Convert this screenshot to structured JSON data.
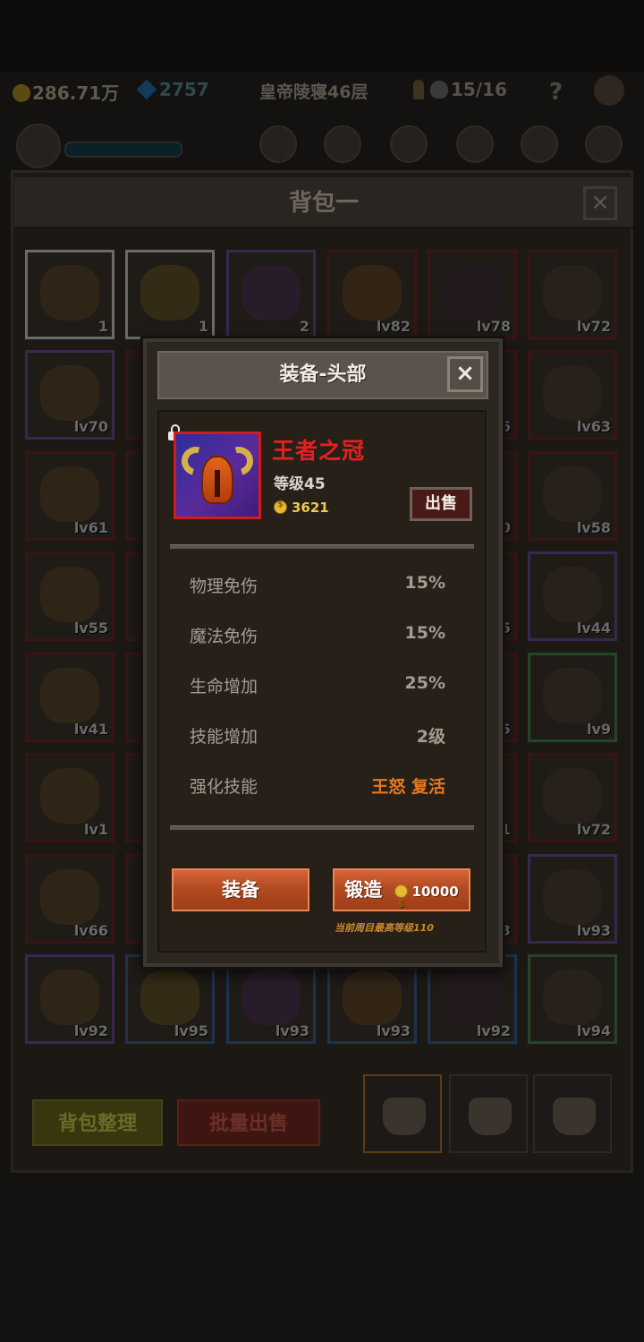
{
  "topbar": {
    "gold": "286.71万",
    "gems": "2757",
    "floor": "皇帝陵寝46层",
    "keys": "15/16",
    "help": "?"
  },
  "bag": {
    "title": "背包一",
    "close": "×",
    "tidy_label": "背包整理",
    "batch_sell_label": "批量出售",
    "slots": [
      {
        "label": "1"
      },
      {
        "label": "1"
      },
      {
        "label": "2"
      },
      {
        "label": "lv82"
      },
      {
        "label": "lv78"
      },
      {
        "label": "lv72"
      },
      {
        "label": "lv70"
      },
      {
        "label": ""
      },
      {
        "label": ""
      },
      {
        "label": ""
      },
      {
        "label": "6"
      },
      {
        "label": "lv63"
      },
      {
        "label": "lv61"
      },
      {
        "label": ""
      },
      {
        "label": ""
      },
      {
        "label": ""
      },
      {
        "label": "0"
      },
      {
        "label": "lv58"
      },
      {
        "label": "lv55"
      },
      {
        "label": ""
      },
      {
        "label": ""
      },
      {
        "label": ""
      },
      {
        "label": "5"
      },
      {
        "label": "lv44"
      },
      {
        "label": "lv41"
      },
      {
        "label": ""
      },
      {
        "label": ""
      },
      {
        "label": ""
      },
      {
        "label": "5"
      },
      {
        "label": "lv9"
      },
      {
        "label": "lv1"
      },
      {
        "label": ""
      },
      {
        "label": ""
      },
      {
        "label": ""
      },
      {
        "label": "1"
      },
      {
        "label": "lv72"
      },
      {
        "label": "lv66"
      },
      {
        "label": ""
      },
      {
        "label": ""
      },
      {
        "label": ""
      },
      {
        "label": "3"
      },
      {
        "label": "lv93"
      },
      {
        "label": "lv92"
      },
      {
        "label": "lv95"
      },
      {
        "label": "lv93"
      },
      {
        "label": "lv93"
      },
      {
        "label": "lv92"
      },
      {
        "label": "lv94"
      }
    ]
  },
  "modal": {
    "title": "装备-头部",
    "close": "×",
    "item": {
      "name": "王者之冠",
      "level": "等级45",
      "price": "3621",
      "sell_label": "出售"
    },
    "stats": [
      {
        "label": "物理免伤",
        "value": "15%"
      },
      {
        "label": "魔法免伤",
        "value": "15%"
      },
      {
        "label": "生命增加",
        "value": "25%"
      },
      {
        "label": "技能增加",
        "value": "2级"
      },
      {
        "label": "强化技能",
        "value": "王怒 复活"
      }
    ],
    "equip_label": "装备",
    "forge_label": "锻造",
    "forge_cost": "10000",
    "hint": "当前周目最高等级110"
  },
  "colors": {
    "item_name": "#e42121",
    "orange_stat": "#e4791e",
    "button": "#c0552a",
    "gold": "#f2c84b"
  }
}
